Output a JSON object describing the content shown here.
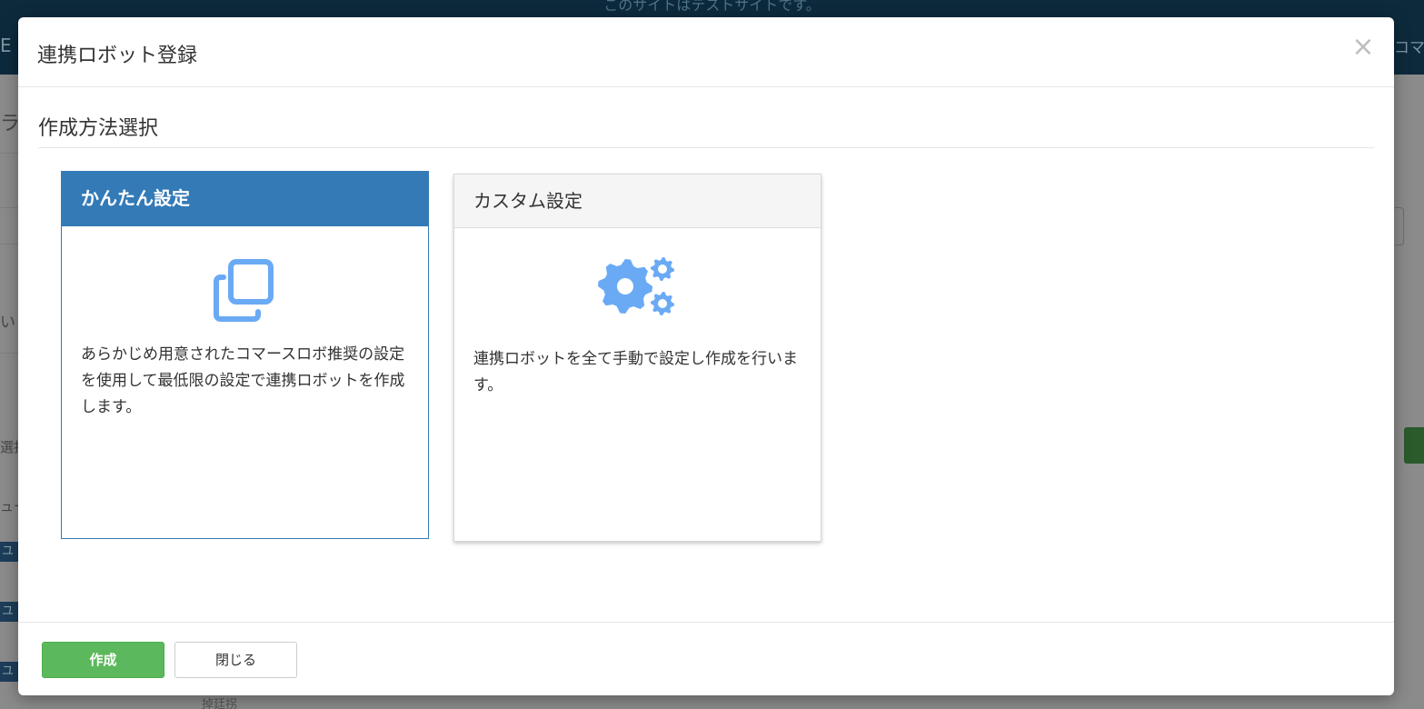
{
  "background": {
    "notice_text": "このサイトはテストサイトです。",
    "brand_fragment": "E",
    "right_fragment": "コマ",
    "left_fragments": [
      "ラ",
      "い",
      "選択",
      "ュー",
      "ユ",
      "ユ",
      "ユ"
    ],
    "bottom_fragment": "掉廷拐"
  },
  "modal": {
    "title": "連携ロボット登録",
    "close_label": "×",
    "section_title": "作成方法選択",
    "cards": [
      {
        "title": "かんたん設定",
        "icon": "copy-icon",
        "description": "あらかじめ用意されたコマースロボ推奨の設定を使用して最低限の設定で連携ロボットを作成します。",
        "selected": true
      },
      {
        "title": "カスタム設定",
        "icon": "gears-icon",
        "description": "連携ロボットを全て手動で設定し作成を行います。",
        "selected": false
      }
    ],
    "footer": {
      "create_label": "作成",
      "close_label": "閉じる"
    }
  },
  "colors": {
    "primary": "#337ab7",
    "icon_blue": "#6aaaf5",
    "success": "#5cb85c"
  }
}
